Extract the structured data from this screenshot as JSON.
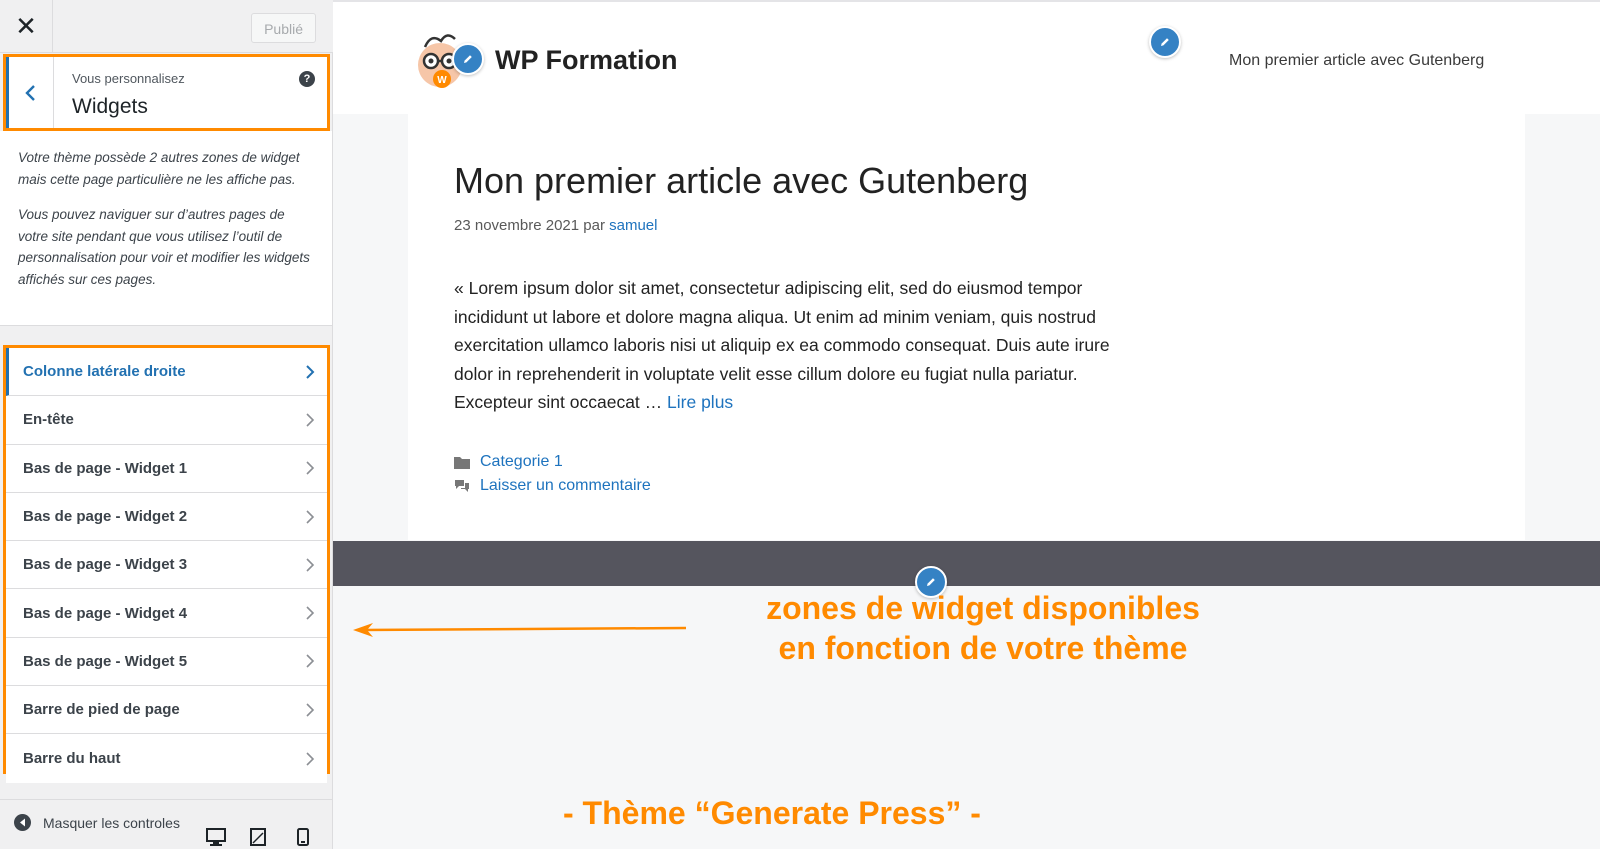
{
  "sidebar": {
    "close_label": "✕",
    "publish_label": "Publié",
    "header": {
      "pre_title": "Vous personnalisez",
      "title": "Widgets",
      "help": "?"
    },
    "description": [
      "Votre thème possède 2 autres zones de widget mais cette page particulière ne les affiche pas.",
      "Vous pouvez naviguer sur d’autres pages de votre site pendant que vous utilisez l’outil de personnalisation pour voir et modifier les widgets affichés sur ces pages."
    ],
    "widget_areas": [
      {
        "label": "Colonne latérale droite"
      },
      {
        "label": "En-tête"
      },
      {
        "label": "Bas de page - Widget 1"
      },
      {
        "label": "Bas de page - Widget 2"
      },
      {
        "label": "Bas de page - Widget 3"
      },
      {
        "label": "Bas de page - Widget 4"
      },
      {
        "label": "Bas de page - Widget 5"
      },
      {
        "label": "Barre de pied de page"
      },
      {
        "label": "Barre du haut"
      }
    ],
    "footer": {
      "hide_controls": "Masquer les controles"
    }
  },
  "preview": {
    "site_title": "WP Formation",
    "nav_item": "Mon premier article avec Gutenberg",
    "post": {
      "title": "Mon premier article avec Gutenberg",
      "date": "23 novembre 2021",
      "by": "par",
      "author": "samuel",
      "excerpt": "« Lorem ipsum dolor sit amet, consectetur adipiscing elit, sed do eiusmod tempor incididunt ut labore et dolore magna aliqua. Ut enim ad minim veniam, quis nostrud exercitation ullamco laboris nisi ut aliquip ex ea commodo consequat. Duis aute irure dolor in reprehenderit in voluptate velit esse cillum dolore eu fugiat nulla pariatur. Excepteur sint occaecat …",
      "read_more": "Lire plus",
      "category": "Categorie 1",
      "comment": "Laisser un commentaire"
    },
    "annotation_line1": "zones de widget disponibles",
    "annotation_line2": "en fonction de votre thème",
    "theme_note": "- Thème “Generate Press” -"
  },
  "colors": {
    "accent": "#2271b1",
    "annotation": "#ff8a00",
    "band": "#55555e"
  }
}
